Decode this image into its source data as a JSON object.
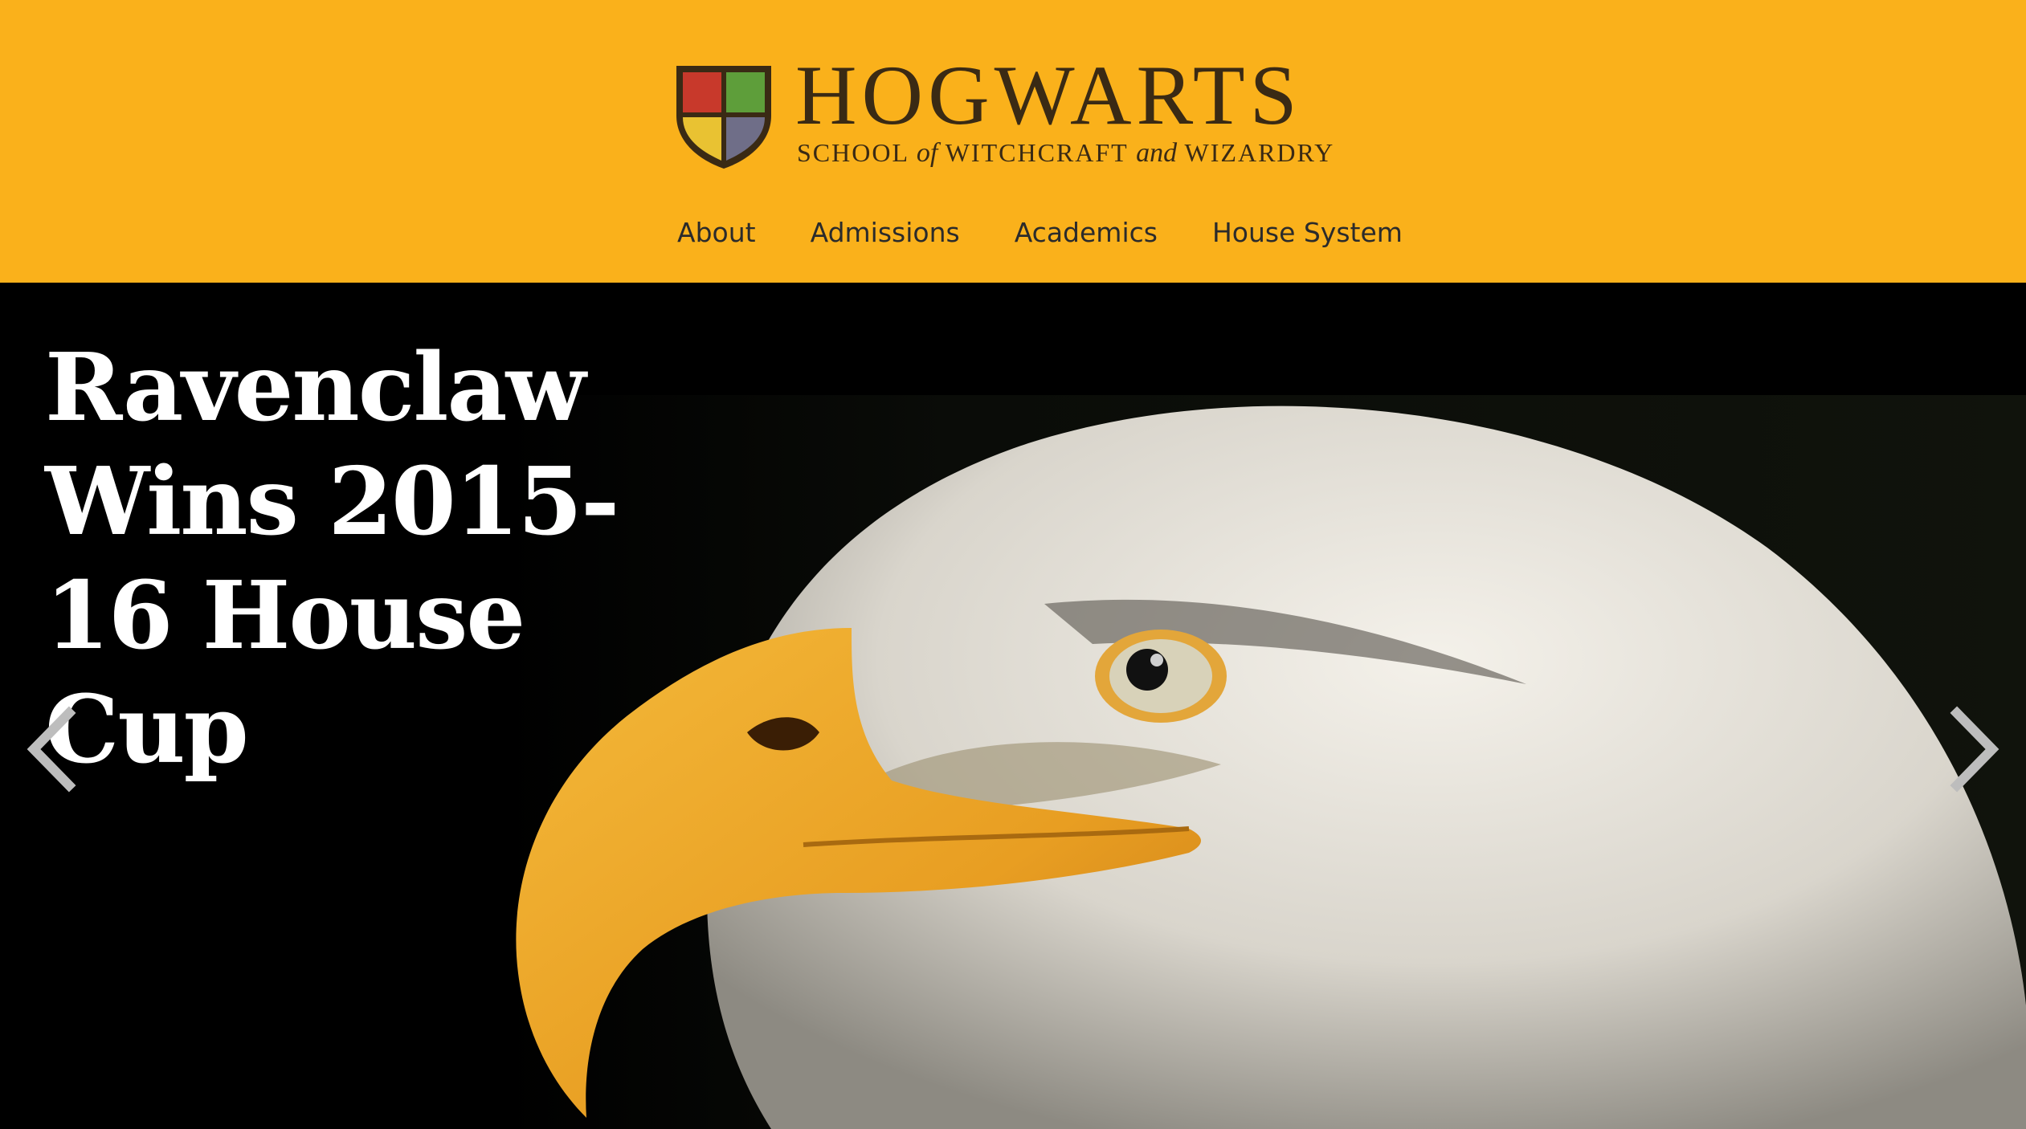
{
  "header": {
    "background_color": "#FAB11B",
    "logo": {
      "wordmark": "HOGWARTS",
      "tagline_school": "SCHOOL",
      "tagline_of": "of",
      "tagline_witchcraft": "WITCHCRAFT",
      "tagline_and": "and",
      "tagline_wizardry": "WIZARDRY",
      "crest_colors": [
        "#C8392B",
        "#5E9E3A",
        "#E9C232",
        "#6F6E88"
      ]
    },
    "nav": [
      {
        "label": "About"
      },
      {
        "label": "Admissions"
      },
      {
        "label": "Academics"
      },
      {
        "label": "House System"
      }
    ]
  },
  "hero": {
    "headline": "Ravenclaw Wins 2015-16 House Cup",
    "image_subject": "bald-eagle-photo",
    "prev_icon": "chevron-left-icon",
    "next_icon": "chevron-right-icon"
  }
}
